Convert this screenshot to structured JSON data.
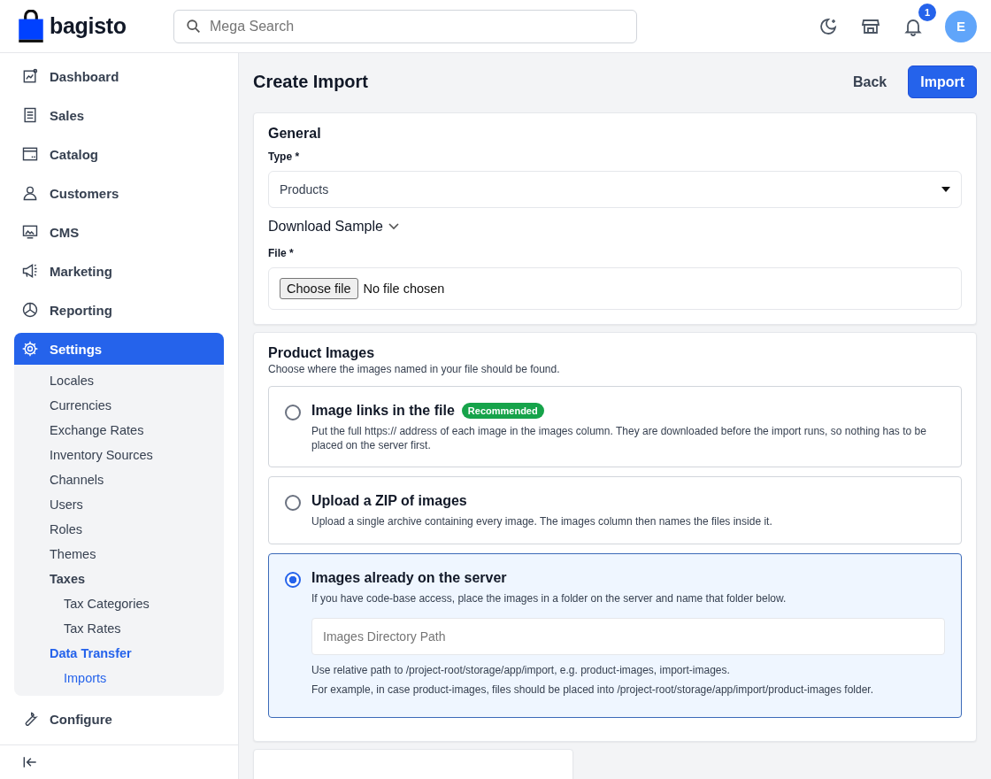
{
  "header": {
    "logo": "bagisto",
    "search": {
      "placeholder": "Mega Search"
    },
    "notifications": "1",
    "avatar": "E"
  },
  "sidebar": {
    "items": [
      {
        "label": "Dashboard",
        "selected": false
      },
      {
        "label": "Sales",
        "selected": false
      },
      {
        "label": "Catalog",
        "selected": false
      },
      {
        "label": "Customers",
        "selected": false
      },
      {
        "label": "CMS",
        "selected": false
      },
      {
        "label": "Marketing",
        "selected": false
      },
      {
        "label": "Reporting",
        "selected": false
      },
      {
        "label": "Settings",
        "selected": true,
        "expanded": true,
        "children": [
          {
            "label": "Locales",
            "selected": false
          },
          {
            "label": "Currencies",
            "selected": false
          },
          {
            "label": "Exchange Rates",
            "selected": false
          },
          {
            "label": "Inventory Sources",
            "selected": false
          },
          {
            "label": "Channels",
            "selected": false
          },
          {
            "label": "Users",
            "selected": false
          },
          {
            "label": "Roles",
            "selected": false
          },
          {
            "label": "Themes",
            "selected": false
          },
          {
            "label": "Taxes",
            "selected": false,
            "children": [
              {
                "label": "Tax Categories",
                "selected": false
              },
              {
                "label": "Tax Rates",
                "selected": false
              }
            ]
          },
          {
            "label": "Data Transfer",
            "selected": true,
            "children": [
              {
                "label": "Imports",
                "selected": true
              }
            ]
          }
        ]
      },
      {
        "label": "Configure",
        "selected": false
      }
    ]
  },
  "page": {
    "title": "Create Import",
    "back": "Back",
    "submit": "Import"
  },
  "general": {
    "title": "General",
    "type_label": "Type *",
    "type_value": "Products",
    "download_sample": "Download Sample",
    "file_label": "File *",
    "choose_file": "Choose file",
    "no_file": "No file chosen"
  },
  "product_images": {
    "title": "Product Images",
    "subtitle": "Choose where the images named in your file should be found.",
    "options": [
      {
        "title": "Image links in the file",
        "badge": "Recommended",
        "description": "Put the full https:// address of each image in the images column. They are downloaded before the import runs, so nothing has to be placed on the server first.",
        "selected": false
      },
      {
        "title": "Upload a ZIP of images",
        "description": "Upload a single archive containing every image. The images column then names the files inside it.",
        "selected": false
      },
      {
        "title": "Images already on the server",
        "description": "If you have code-base access, place the images in a folder on the server and name that folder below.",
        "selected": true,
        "field": {
          "placeholder": "Images Directory Path"
        },
        "hints": [
          "Use relative path to /project-root/storage/app/import, e.g. product-images, import-images.",
          "For example, in case product-images, files should be placed into /project-root/storage/app/import/product-images folder."
        ]
      }
    ]
  }
}
